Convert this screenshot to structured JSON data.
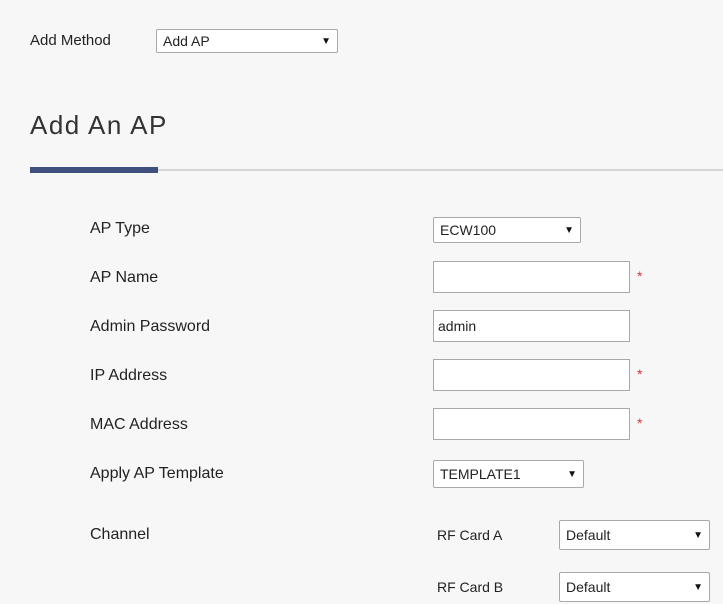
{
  "method": {
    "label": "Add Method",
    "selected": "Add AP"
  },
  "section": {
    "title": "Add An AP"
  },
  "form": {
    "ap_type": {
      "label": "AP Type",
      "selected": "ECW100"
    },
    "ap_name": {
      "label": "AP Name",
      "value": "",
      "required_mark": "*"
    },
    "admin_password": {
      "label": "Admin Password",
      "value": "admin"
    },
    "ip_address": {
      "label": "IP Address",
      "value": "",
      "required_mark": "*"
    },
    "mac_address": {
      "label": "MAC Address",
      "value": "",
      "required_mark": "*"
    },
    "ap_template": {
      "label": "Apply AP Template",
      "selected": "TEMPLATE1"
    },
    "channel": {
      "label": "Channel",
      "rf_card_a": {
        "label": "RF Card A",
        "selected": "Default"
      },
      "rf_card_b": {
        "label": "RF Card B",
        "selected": "Default"
      }
    }
  },
  "icons": {
    "dropdown": "chevron-down-icon"
  },
  "colors": {
    "accent": "#3f4f7e",
    "required": "#e0333a",
    "background": "#f7f7f7"
  }
}
